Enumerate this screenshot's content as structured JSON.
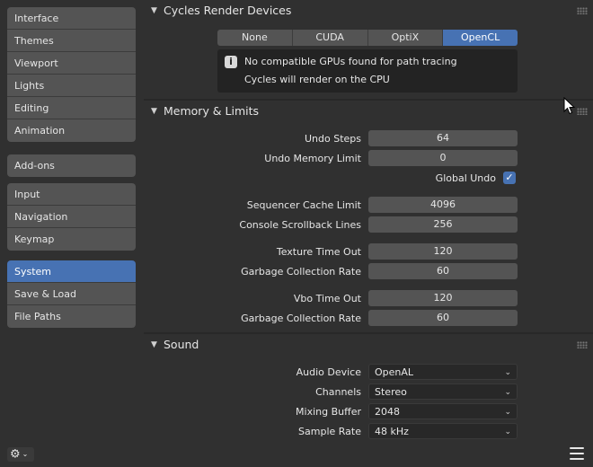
{
  "sidebar": {
    "groups": [
      [
        "Interface",
        "Themes",
        "Viewport",
        "Lights",
        "Editing",
        "Animation"
      ],
      [
        "Add-ons"
      ],
      [
        "Input",
        "Navigation",
        "Keymap"
      ],
      [
        "System",
        "Save & Load",
        "File Paths"
      ]
    ],
    "active": "System"
  },
  "cycles": {
    "title": "Cycles Render Devices",
    "devices": [
      "None",
      "CUDA",
      "OptiX",
      "OpenCL"
    ],
    "active_device": "OpenCL",
    "info_lines": [
      "No compatible GPUs found for path tracing",
      "Cycles will render on the CPU"
    ]
  },
  "memory": {
    "title": "Memory & Limits",
    "undo_steps_label": "Undo Steps",
    "undo_steps": "64",
    "undo_memory_label": "Undo Memory Limit",
    "undo_memory": "0",
    "global_undo_label": "Global Undo",
    "global_undo": true,
    "seq_cache_label": "Sequencer Cache Limit",
    "seq_cache": "4096",
    "console_scroll_label": "Console Scrollback Lines",
    "console_scroll": "256",
    "tex_timeout_label": "Texture Time Out",
    "tex_timeout": "120",
    "tex_gc_label": "Garbage Collection Rate",
    "tex_gc": "60",
    "vbo_timeout_label": "Vbo Time Out",
    "vbo_timeout": "120",
    "vbo_gc_label": "Garbage Collection Rate",
    "vbo_gc": "60"
  },
  "sound": {
    "title": "Sound",
    "audio_device_label": "Audio Device",
    "audio_device": "OpenAL",
    "channels_label": "Channels",
    "channels": "Stereo",
    "mixing_buffer_label": "Mixing Buffer",
    "mixing_buffer": "2048",
    "sample_rate_label": "Sample Rate",
    "sample_rate": "48 kHz"
  },
  "icons": {
    "panel_expanded": "▼",
    "info": "i",
    "check": "✓",
    "chevron": "⌄",
    "gear": "⚙"
  },
  "colors": {
    "accent": "#4772b3",
    "panel": "#303030",
    "field": "#545454"
  }
}
